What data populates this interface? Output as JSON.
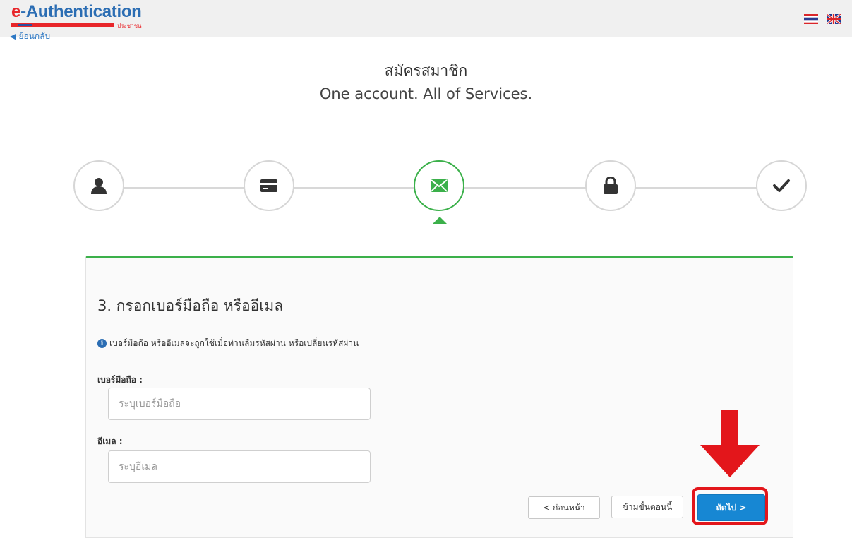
{
  "header": {
    "logo_e": "e",
    "logo_rest": "-Authentication",
    "logo_sub": "ประชาชน",
    "back_label": "ย้อนกลับ",
    "languages": [
      {
        "code": "th",
        "icon": "thailand-flag-icon"
      },
      {
        "code": "en",
        "icon": "uk-flag-icon"
      }
    ]
  },
  "page": {
    "title_th": "สมัครสมาชิก",
    "title_en": "One account. All of Services."
  },
  "steps": [
    {
      "icon": "user-icon",
      "state": "done"
    },
    {
      "icon": "id-card-icon",
      "state": "done"
    },
    {
      "icon": "envelope-icon",
      "state": "active"
    },
    {
      "icon": "lock-icon",
      "state": "pending"
    },
    {
      "icon": "checkmark-icon",
      "state": "pending"
    }
  ],
  "form": {
    "title": "3. กรอกเบอร์มือถือ หรืออีเมล",
    "info": "เบอร์มือถือ หรืออีเมลจะถูกใช้เมื่อท่านลืมรหัสผ่าน หรือเปลี่ยนรหัสผ่าน",
    "phone_label": "เบอร์มือถือ :",
    "phone_placeholder": "ระบุเบอร์มือถือ",
    "phone_value": "",
    "email_label": "อีเมล :",
    "email_placeholder": "ระบุอีเมล",
    "email_value": ""
  },
  "buttons": {
    "prev": "< ก่อนหน้า",
    "skip": "ข้ามขั้นตอนนี้",
    "next": "ถัดไป >"
  },
  "colors": {
    "accent_green": "#3bb04a",
    "primary_blue": "#1787d3",
    "annotation_red": "#e3161b",
    "logo_red": "#e8262a",
    "logo_blue": "#2b6db3"
  }
}
